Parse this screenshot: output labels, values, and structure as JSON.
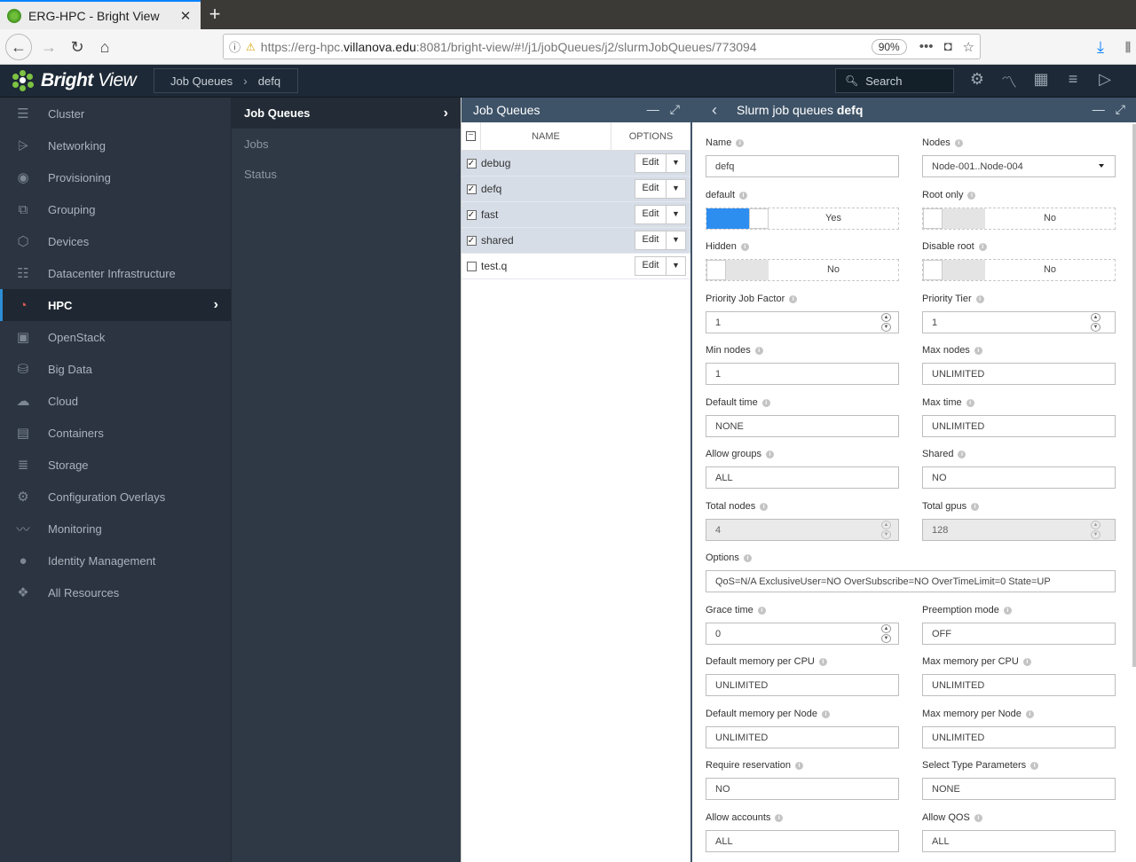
{
  "browser": {
    "tab_title": "ERG-HPC - Bright View",
    "url_prefix": "https://erg-hpc.",
    "url_domain": "villanova.edu",
    "url_suffix": ":8081/bright-view/#!/j1/jobQueues/j2/slurmJobQueues/773094",
    "zoom": "90%"
  },
  "app": {
    "logo_bold": "Bright",
    "logo_light": " View",
    "breadcrumb": [
      "Job Queues",
      "defq"
    ],
    "search_placeholder": "Search"
  },
  "sidebar": {
    "items": [
      {
        "label": "Cluster",
        "icon": "cluster-icon"
      },
      {
        "label": "Networking",
        "icon": "network-icon"
      },
      {
        "label": "Provisioning",
        "icon": "provisioning-icon"
      },
      {
        "label": "Grouping",
        "icon": "grouping-icon"
      },
      {
        "label": "Devices",
        "icon": "devices-icon"
      },
      {
        "label": "Datacenter Infrastructure",
        "icon": "datacenter-icon"
      },
      {
        "label": "HPC",
        "icon": "gauge-icon",
        "active": true
      },
      {
        "label": "OpenStack",
        "icon": "openstack-icon"
      },
      {
        "label": "Big Data",
        "icon": "database-icon"
      },
      {
        "label": "Cloud",
        "icon": "cloud-icon"
      },
      {
        "label": "Containers",
        "icon": "containers-icon"
      },
      {
        "label": "Storage",
        "icon": "storage-icon"
      },
      {
        "label": "Configuration Overlays",
        "icon": "gears-icon"
      },
      {
        "label": "Monitoring",
        "icon": "chart-icon"
      },
      {
        "label": "Identity Management",
        "icon": "user-icon"
      },
      {
        "label": "All Resources",
        "icon": "cubes-icon"
      }
    ]
  },
  "subnav": {
    "items": [
      "Job Queues",
      "Jobs",
      "Status"
    ]
  },
  "queues": {
    "title": "Job Queues",
    "col_name": "NAME",
    "col_options": "OPTIONS",
    "edit_label": "Edit",
    "rows": [
      {
        "name": "debug",
        "checked": true
      },
      {
        "name": "defq",
        "checked": true
      },
      {
        "name": "fast",
        "checked": true
      },
      {
        "name": "shared",
        "checked": true
      },
      {
        "name": "test.q",
        "checked": false
      }
    ]
  },
  "detail": {
    "title_prefix": "Slurm job queues",
    "title_name": "defq",
    "fields": {
      "name": {
        "label": "Name",
        "value": "defq"
      },
      "nodes": {
        "label": "Nodes",
        "value": "Node-001..Node-004"
      },
      "default": {
        "label": "default",
        "value": "Yes"
      },
      "root_only": {
        "label": "Root only",
        "value": "No"
      },
      "hidden": {
        "label": "Hidden",
        "value": "No"
      },
      "disable_root": {
        "label": "Disable root",
        "value": "No"
      },
      "priority_job_factor": {
        "label": "Priority Job Factor",
        "value": "1"
      },
      "priority_tier": {
        "label": "Priority Tier",
        "value": "1"
      },
      "min_nodes": {
        "label": "Min nodes",
        "value": "1"
      },
      "max_nodes": {
        "label": "Max nodes",
        "value": "UNLIMITED"
      },
      "default_time": {
        "label": "Default time",
        "value": "NONE"
      },
      "max_time": {
        "label": "Max time",
        "value": "UNLIMITED"
      },
      "allow_groups": {
        "label": "Allow groups",
        "value": "ALL"
      },
      "shared": {
        "label": "Shared",
        "value": "NO"
      },
      "total_nodes": {
        "label": "Total nodes",
        "value": "4"
      },
      "total_gpus": {
        "label": "Total gpus",
        "value": "128"
      },
      "options": {
        "label": "Options",
        "value": "QoS=N/A ExclusiveUser=NO OverSubscribe=NO OverTimeLimit=0 State=UP"
      },
      "grace_time": {
        "label": "Grace time",
        "value": "0"
      },
      "preemption_mode": {
        "label": "Preemption mode",
        "value": "OFF"
      },
      "default_mem_cpu": {
        "label": "Default memory per CPU",
        "value": "UNLIMITED"
      },
      "max_mem_cpu": {
        "label": "Max memory per CPU",
        "value": "UNLIMITED"
      },
      "default_mem_node": {
        "label": "Default memory per Node",
        "value": "UNLIMITED"
      },
      "max_mem_node": {
        "label": "Max memory per Node",
        "value": "UNLIMITED"
      },
      "require_reservation": {
        "label": "Require reservation",
        "value": "NO"
      },
      "select_type_params": {
        "label": "Select Type Parameters",
        "value": "NONE"
      },
      "allow_accounts": {
        "label": "Allow accounts",
        "value": "ALL"
      },
      "allow_qos": {
        "label": "Allow QOS",
        "value": "ALL"
      }
    }
  },
  "colors": {
    "accent": "#2d8ef0",
    "header": "#1d2936",
    "sidebar": "#2b3440",
    "panel_head": "#3e5368"
  }
}
